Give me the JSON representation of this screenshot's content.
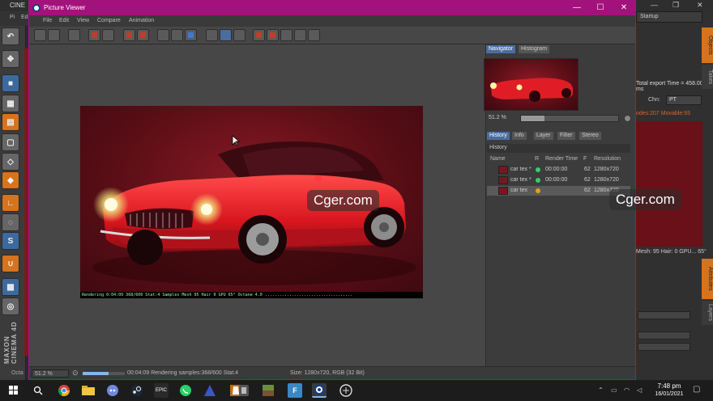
{
  "bg_app": {
    "title": "CINE",
    "menu": [
      "Pi",
      "Ed"
    ],
    "startup_dropdown": "Startup",
    "export_time": "Total export Time = 458.005 ms",
    "chn_label": "Chn:",
    "chn_value": "PT",
    "nodes_text": "odes:207 Movable:93",
    "stats_text": "Mesh: 95    Hair: 0    GPU...  65°",
    "side_tabs": [
      "Objects",
      "Takes",
      "Attributes",
      "Layers"
    ],
    "status_left": "Octa",
    "logo_text": "MAXON CINEMA 4D"
  },
  "viewer": {
    "title": "Picture Viewer",
    "menu": [
      "File",
      "Edit",
      "View",
      "Compare",
      "Animation"
    ],
    "status": {
      "zoom": "51.2 %",
      "render_text": "00:04:09 Rendering samples:368/600 Stat:4",
      "size_text": "Size: 1280x720, RGB (32 Bit)",
      "progress": 0.61
    },
    "panel_tabs_top": [
      "Navigator",
      "Histogram"
    ],
    "navigator_zoom": "51.2 %",
    "panel_tabs": [
      "History",
      "Info",
      "Layer",
      "Filter",
      "Stereo"
    ],
    "history_title": "History",
    "history_columns": [
      "Name",
      "R",
      "Render Time",
      "F",
      "Resolution"
    ],
    "history_rows": [
      {
        "name": "car tex *",
        "status_color": "#3ec96b",
        "time": "00:00:00",
        "frame": "62",
        "resolution": "1280x720"
      },
      {
        "name": "car tex *",
        "status_color": "#3ec96b",
        "time": "00:00:00",
        "frame": "62",
        "resolution": "1280x720"
      },
      {
        "name": "car tex",
        "status_color": "#e0a21e",
        "time": "",
        "frame": "62",
        "resolution": "1280x720"
      }
    ],
    "render_info": "Rendering  0:04:09  368/600  Stat:4  Samples  Mesh 95  Hair 0  GPU 65°  Octane 4.0  ...................................."
  },
  "watermarks": [
    "Cger.com",
    "Cger.com"
  ],
  "taskbar": {
    "icons": [
      "windows-icon",
      "search-icon",
      "chrome-icon",
      "explorer-icon",
      "discord-icon",
      "steam-icon",
      "epic-icon",
      "whatsapp-icon",
      "app-icon",
      "vlc-icon",
      "app2-icon",
      "minecraft-icon",
      "f-icon",
      "cinema4d-icon",
      "app3-icon"
    ],
    "epic_label": "EPIC",
    "f_label": "F",
    "time": "7:48 pm",
    "date": "16/01/2021"
  }
}
